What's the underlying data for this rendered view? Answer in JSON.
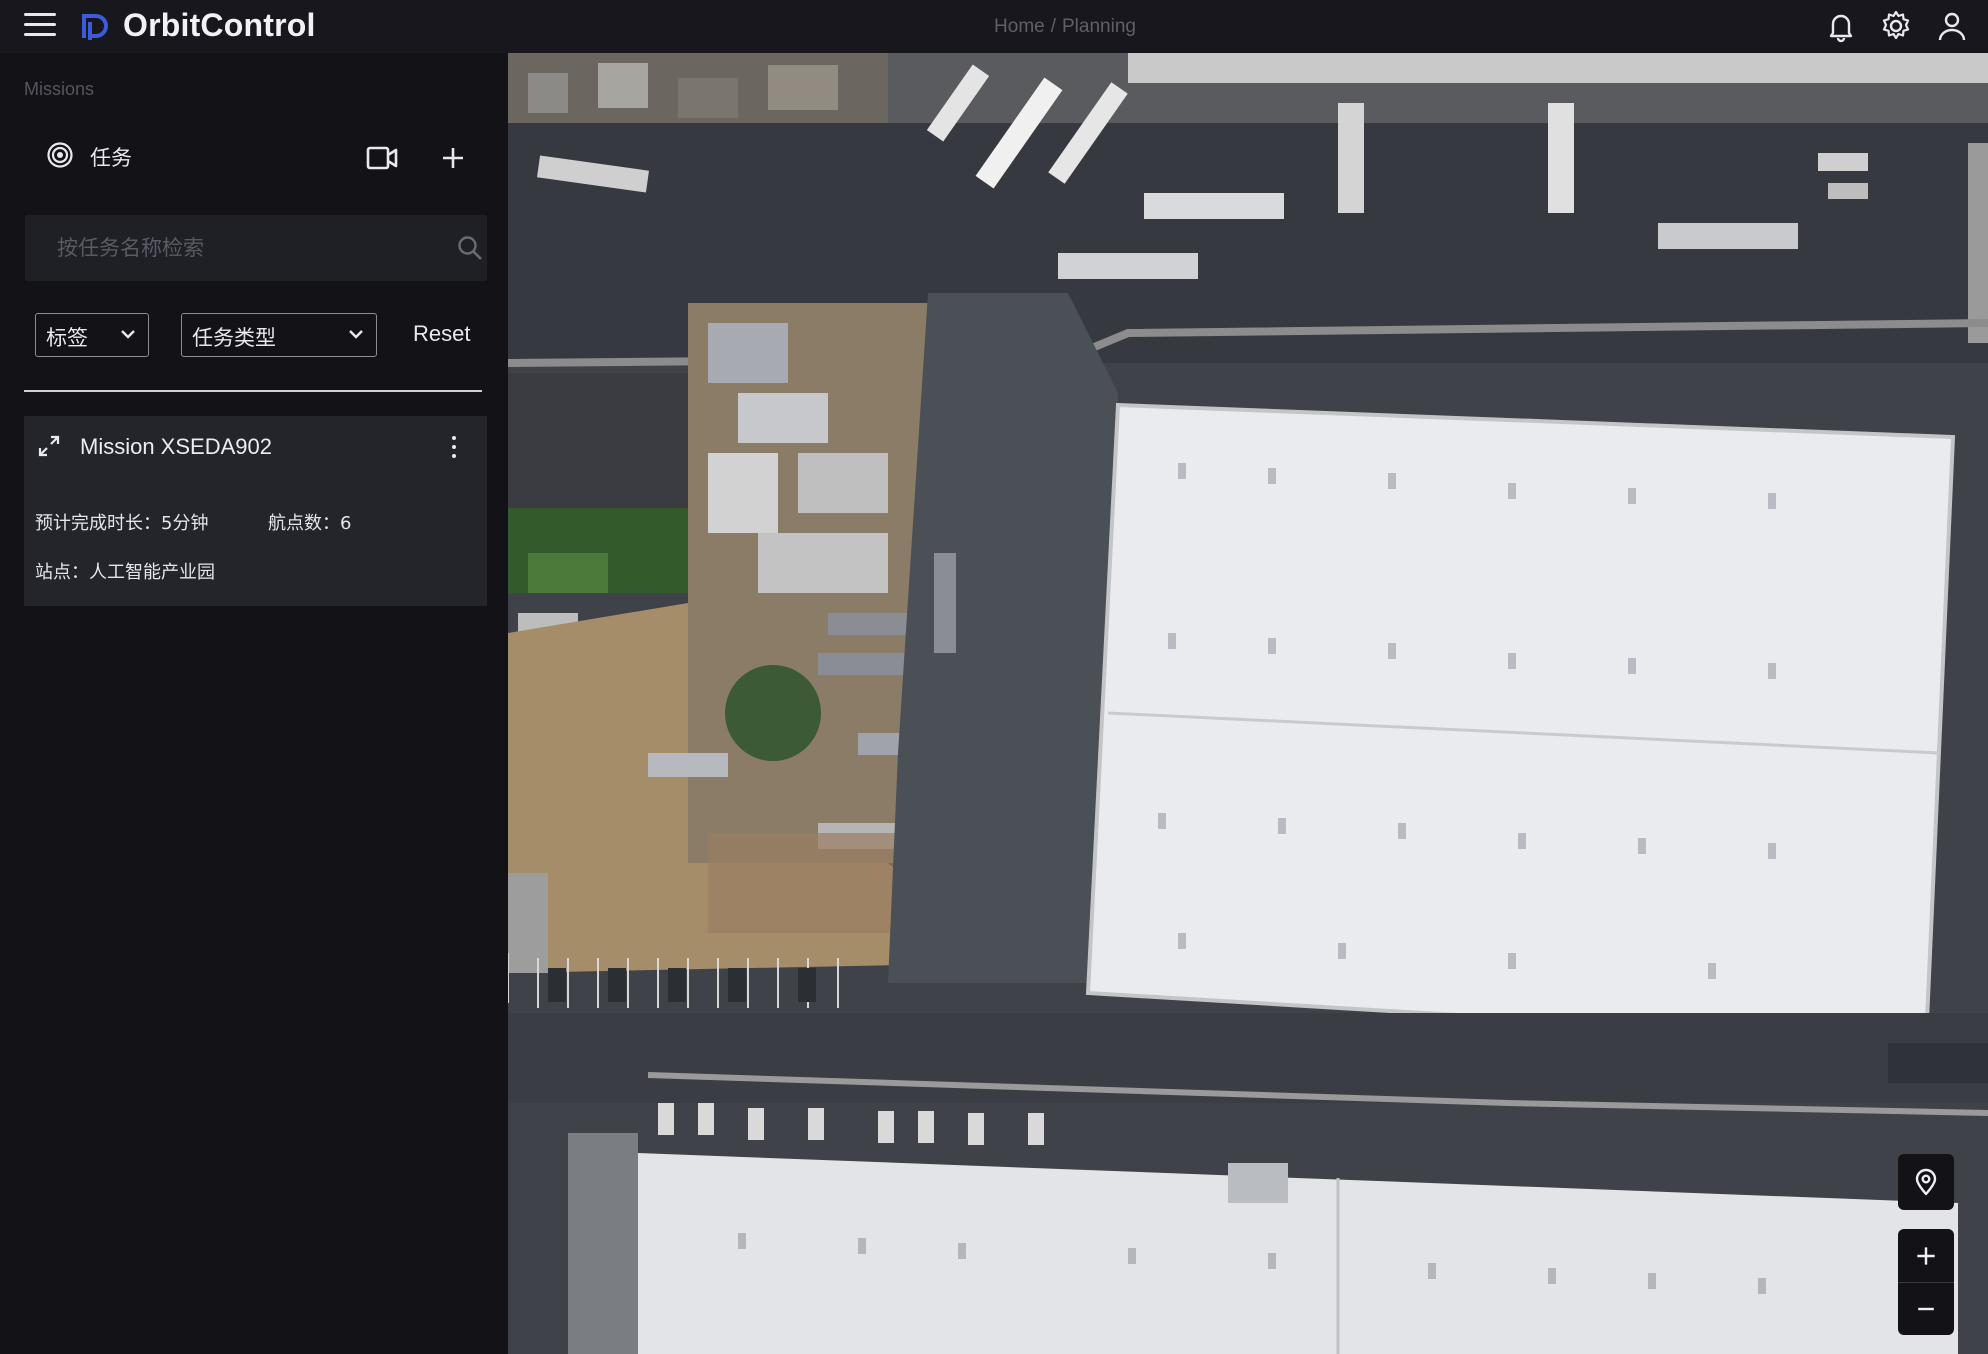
{
  "app": {
    "title": "OrbitControl"
  },
  "breadcrumb": {
    "home": "Home",
    "separator": "/",
    "current": "Planning"
  },
  "header_icons": [
    "bell-icon",
    "gear-icon",
    "user-icon"
  ],
  "sidebar": {
    "section_label": "Missions",
    "tab_label": "任务",
    "search_placeholder": "按任务名称检索",
    "filters": {
      "tag_label": "标签",
      "type_label": "任务类型",
      "reset_label": "Reset"
    },
    "missions": [
      {
        "name": "Mission XSEDA902",
        "duration_label": "预计完成时长：5分钟",
        "waypoints_label": "航点数：6",
        "site_label": "站点：人工智能产业园"
      }
    ]
  },
  "map_controls": [
    "location-pin-icon",
    "zoom-in-icon",
    "zoom-out-icon"
  ],
  "colors": {
    "topbar": "#17171d",
    "sidebar": "#121217",
    "card": "#24242b",
    "accent_logo": "#3b5bdb"
  }
}
